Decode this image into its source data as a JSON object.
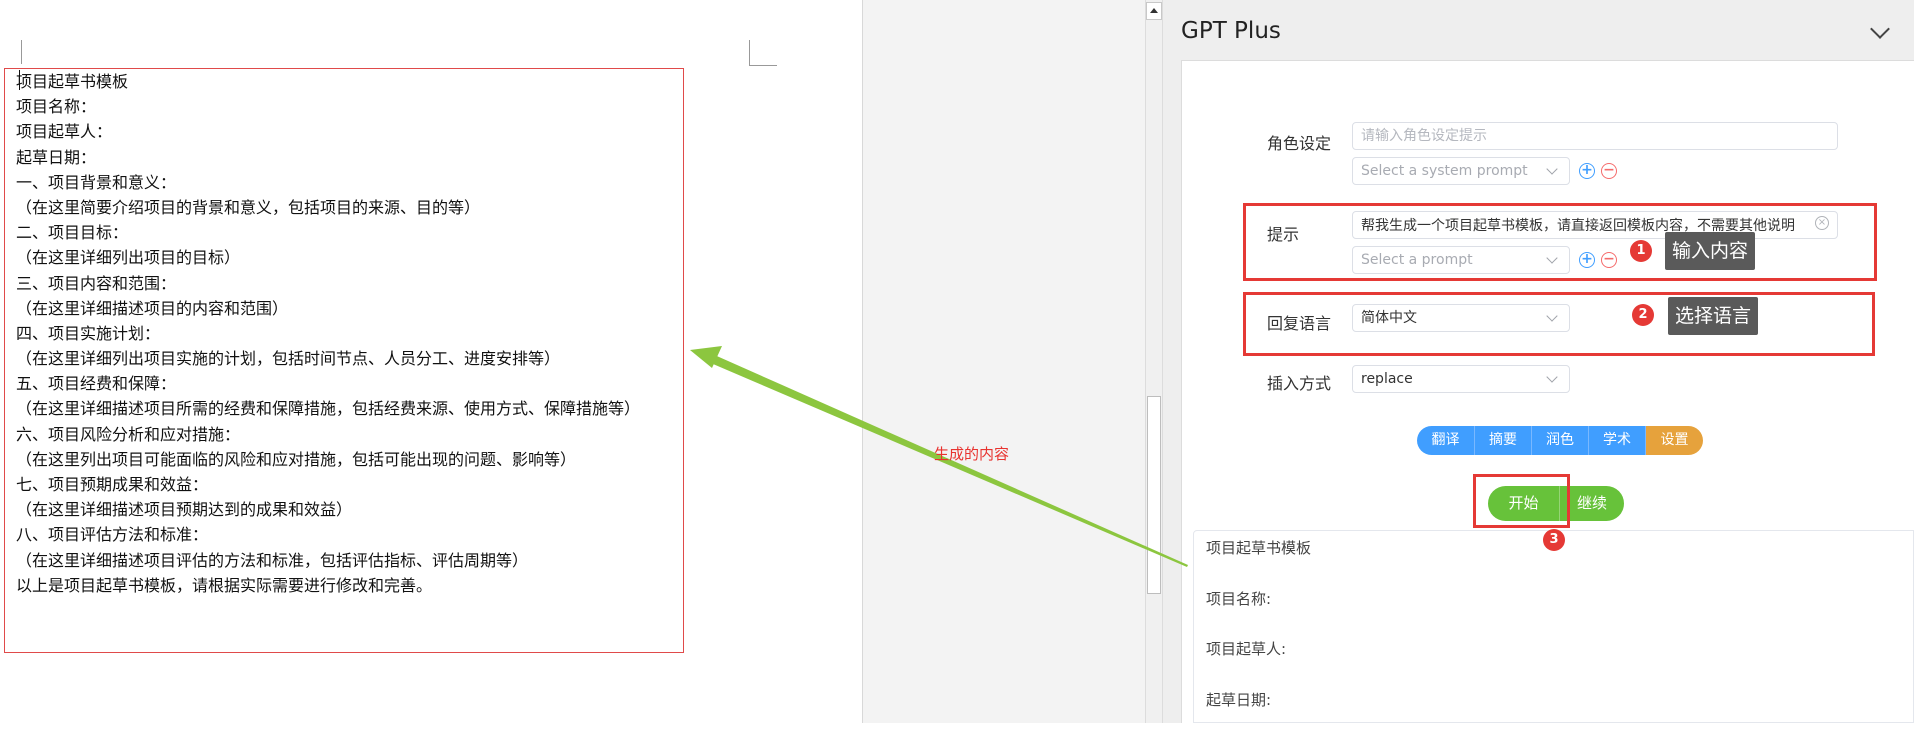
{
  "document": {
    "lines": [
      "项目起草书模板",
      "项目名称：",
      "项目起草人：",
      "起草日期：",
      "一、项目背景和意义：",
      "（在这里简要介绍项目的背景和意义，包括项目的来源、目的等）",
      "二、项目目标：",
      "（在这里详细列出项目的目标）",
      "三、项目内容和范围：",
      "（在这里详细描述项目的内容和范围）",
      "四、项目实施计划：",
      "（在这里详细列出项目实施的计划，包括时间节点、人员分工、进度安排等）",
      "五、项目经费和保障：",
      "（在这里详细描述项目所需的经费和保障措施，包括经费来源、使用方式、保障措施等）",
      "六、项目风险分析和应对措施：",
      "（在这里列出项目可能面临的风险和应对措施，包括可能出现的问题、影响等）",
      "七、项目预期成果和效益：",
      "（在这里详细描述项目预期达到的成果和效益）",
      "八、项目评估方法和标准：",
      "（在这里详细描述项目评估的方法和标准，包括评估指标、评估周期等）",
      "以上是项目起草书模板，请根据实际需要进行修改和完善。"
    ]
  },
  "annotation": {
    "generated_content_label": "生成的内容",
    "arrow_color": "#8cc63f",
    "box_color": "#e53935"
  },
  "panel": {
    "title": "GPT Plus",
    "role": {
      "label": "角色设定",
      "placeholder": "请输入角色设定提示",
      "system_prompt_placeholder": "Select a system prompt"
    },
    "prompt": {
      "label": "提示",
      "value": "帮我生成一个项目起草书模板，请直接返回模板内容，不需要其他说明",
      "prompt_select_placeholder": "Select a prompt"
    },
    "reply_language": {
      "label": "回复语言",
      "value": "简体中文"
    },
    "insert_mode": {
      "label": "插入方式",
      "value": "replace"
    },
    "actions": [
      "翻译",
      "摘要",
      "润色",
      "学术",
      "设置"
    ],
    "start_label": "开始",
    "continue_label": "继续",
    "steps": [
      {
        "number": "1",
        "tooltip": "输入内容"
      },
      {
        "number": "2",
        "tooltip": "选择语言"
      },
      {
        "number": "3"
      }
    ],
    "output_lines": [
      "项目起草书模板",
      "项目名称:",
      "项目起草人:",
      "起草日期:"
    ],
    "colors": {
      "primary": "#409eff",
      "warning": "#e6a23c",
      "success": "#67c23a",
      "danger": "#f56c6c"
    }
  }
}
